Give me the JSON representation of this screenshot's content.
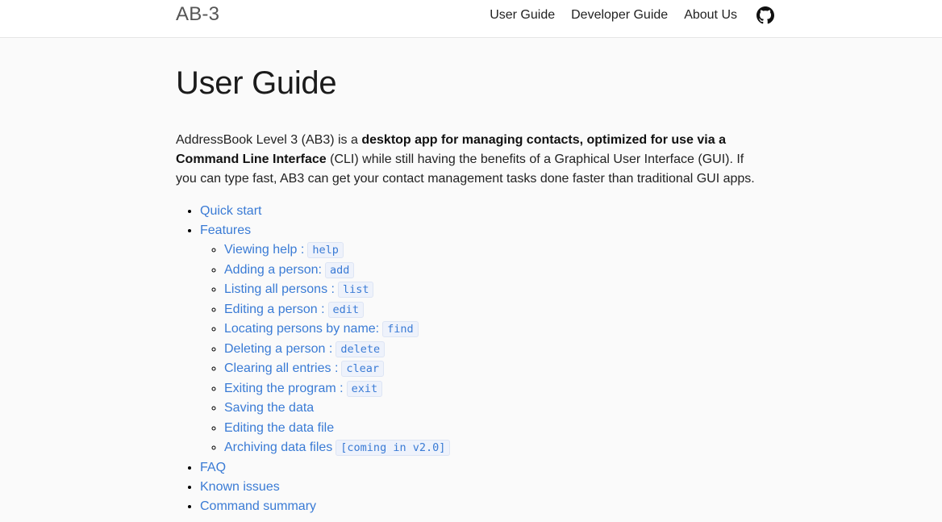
{
  "header": {
    "brand": "AB-3",
    "nav": [
      "User Guide",
      "Developer Guide",
      "About Us"
    ],
    "github_icon": "github-icon"
  },
  "page": {
    "title": "User Guide",
    "intro": {
      "part1": "AddressBook Level 3 (AB3) is a ",
      "bold1": "desktop app for managing contacts, optimized for use via a Command Line Interface",
      "part2": " (CLI) while still having the benefits of a Graphical User Interface (GUI). If you can type fast, AB3 can get your contact management tasks done faster than traditional GUI apps."
    }
  },
  "toc": {
    "quick_start": "Quick start",
    "features": "Features",
    "features_items": [
      {
        "label": "Viewing help :",
        "code": "help"
      },
      {
        "label": "Adding a person:",
        "code": "add"
      },
      {
        "label": "Listing all persons :",
        "code": "list"
      },
      {
        "label": "Editing a person :",
        "code": "edit"
      },
      {
        "label": "Locating persons by name:",
        "code": "find"
      },
      {
        "label": "Deleting a person :",
        "code": "delete"
      },
      {
        "label": "Clearing all entries :",
        "code": "clear"
      },
      {
        "label": "Exiting the program :",
        "code": "exit"
      },
      {
        "label": "Saving the data",
        "code": ""
      },
      {
        "label": "Editing the data file",
        "code": ""
      },
      {
        "label": "Archiving data files",
        "code": "[coming in v2.0]"
      }
    ],
    "faq": "FAQ",
    "known_issues": "Known issues",
    "command_summary": "Command summary"
  },
  "colors": {
    "link": "#3a7bd5",
    "code_bg": "#eef2fb"
  }
}
